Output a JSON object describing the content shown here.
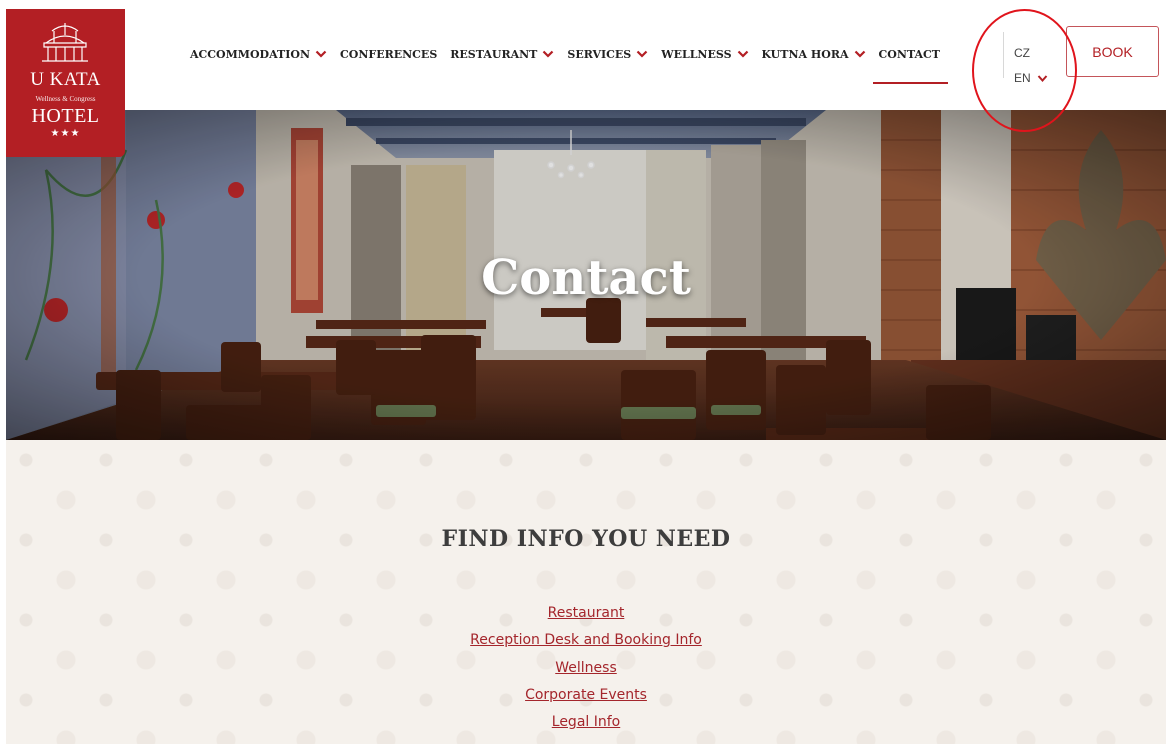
{
  "logo": {
    "name": "U KATA",
    "subtitle": "Wellness & Congress",
    "hotel": "HOTEL",
    "stars": "★★★"
  },
  "nav": {
    "items": [
      {
        "label": "ACCOMMODATION",
        "dropdown": true
      },
      {
        "label": "CONFERENCES",
        "dropdown": false
      },
      {
        "label": "RESTAURANT",
        "dropdown": true
      },
      {
        "label": "SERVICES",
        "dropdown": true
      },
      {
        "label": "WELLNESS",
        "dropdown": true
      },
      {
        "label": "KUTNA HORA",
        "dropdown": true
      },
      {
        "label": "CONTACT",
        "dropdown": false,
        "active": true
      }
    ]
  },
  "language": {
    "options": [
      "CZ"
    ],
    "selected": "EN"
  },
  "book_label": "BOOK",
  "hero": {
    "title": "Contact"
  },
  "info": {
    "title": "FIND INFO YOU NEED",
    "links": [
      "Restaurant",
      "Reception Desk and Booking Info",
      "Wellness",
      "Corporate Events",
      "Legal Info"
    ]
  },
  "colors": {
    "brand": "#b31f24",
    "link": "#a4262c",
    "highlight_circle": "#e0141c",
    "content_bg": "#f5f1ec"
  }
}
